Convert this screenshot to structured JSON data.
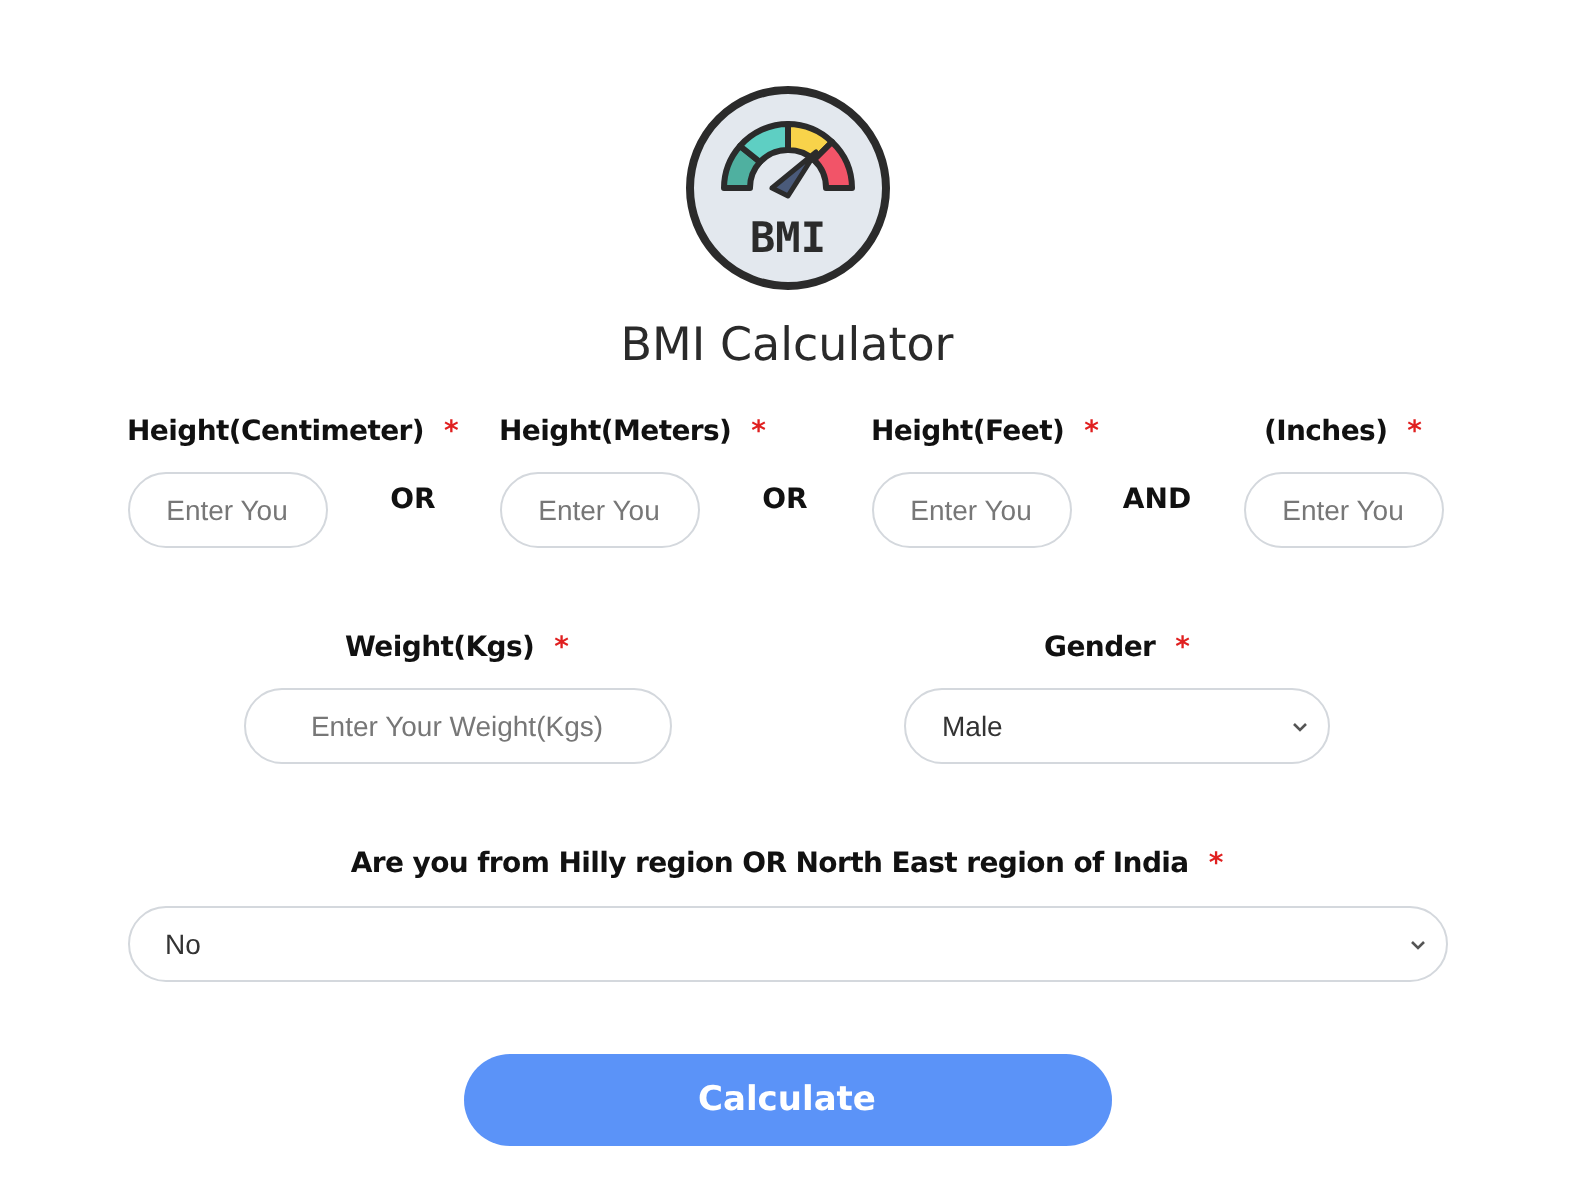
{
  "logo": {
    "text": "BMI"
  },
  "title": "BMI Calculator",
  "height_fields": [
    {
      "label": "Height(Centimeter)",
      "mark": "*",
      "placeholder": "Enter You"
    },
    {
      "label": "Height(Meters)",
      "mark": "*",
      "placeholder": "Enter You"
    },
    {
      "label": "Height(Feet)",
      "mark": "*",
      "placeholder": "Enter You"
    },
    {
      "label": "(Inches)",
      "mark": "*",
      "placeholder": "Enter You"
    }
  ],
  "connectors": [
    "OR",
    "OR",
    "AND"
  ],
  "weight": {
    "label": "Weight(Kgs)",
    "mark": "*",
    "placeholder": "Enter Your Weight(Kgs)"
  },
  "gender": {
    "label": "Gender",
    "mark": "*",
    "value": "Male"
  },
  "region": {
    "label": "Are you from Hilly region OR North East region of India",
    "mark": "*",
    "value": "No"
  },
  "button": "Calculate"
}
